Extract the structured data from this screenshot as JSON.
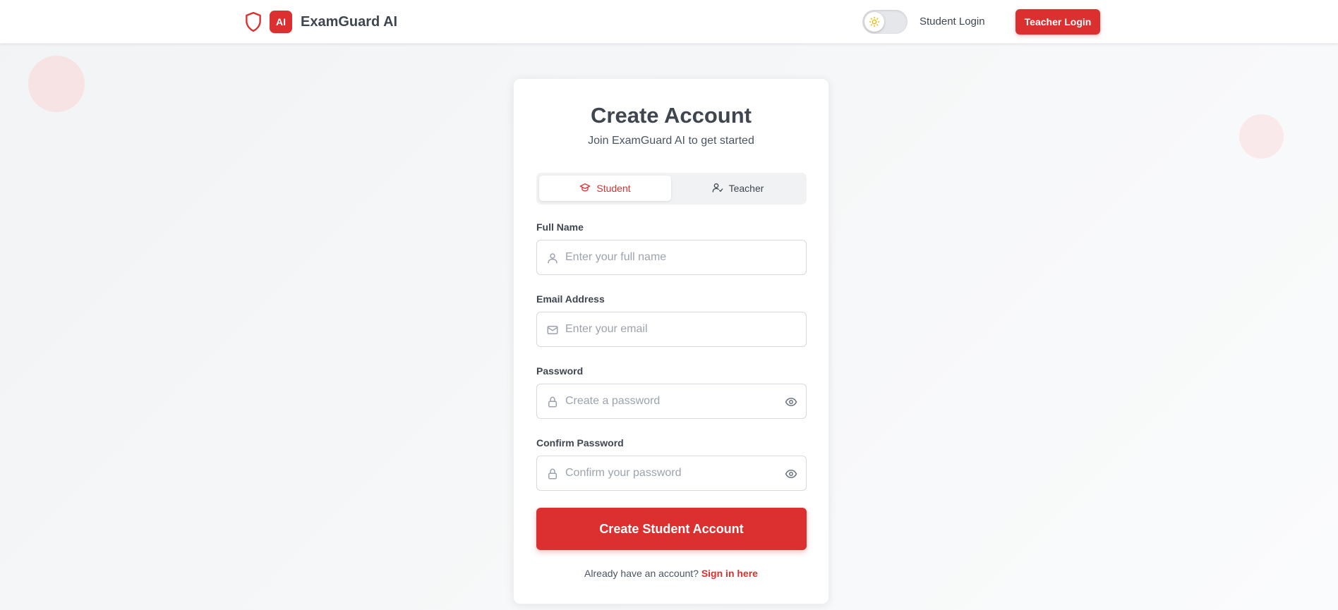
{
  "brand": {
    "badge": "AI",
    "name": "ExamGuard AI"
  },
  "nav": {
    "student_login": "Student Login",
    "teacher_login": "Teacher Login"
  },
  "theme": {
    "mode": "light",
    "icon": "sun-icon"
  },
  "card": {
    "title": "Create Account",
    "subtitle": "Join ExamGuard AI to get started",
    "tabs": [
      {
        "label": "Student",
        "icon": "graduation-cap-icon",
        "active": true
      },
      {
        "label": "Teacher",
        "icon": "user-check-icon",
        "active": false
      }
    ],
    "fields": {
      "full_name": {
        "label": "Full Name",
        "placeholder": "Enter your full name",
        "value": "",
        "icon": "user-icon"
      },
      "email": {
        "label": "Email Address",
        "placeholder": "Enter your email",
        "value": "",
        "icon": "mail-icon"
      },
      "password": {
        "label": "Password",
        "placeholder": "Create a password",
        "value": "",
        "icon": "lock-icon"
      },
      "confirm_password": {
        "label": "Confirm Password",
        "placeholder": "Confirm your password",
        "value": "",
        "icon": "lock-icon"
      }
    },
    "submit_label": "Create Student Account",
    "footer": {
      "text": "Already have an account?",
      "link": "Sign in here"
    }
  },
  "colors": {
    "accent": "#dc2f2f",
    "text": "#3f4650",
    "muted": "#9ca3af",
    "border": "#d6d9de"
  }
}
